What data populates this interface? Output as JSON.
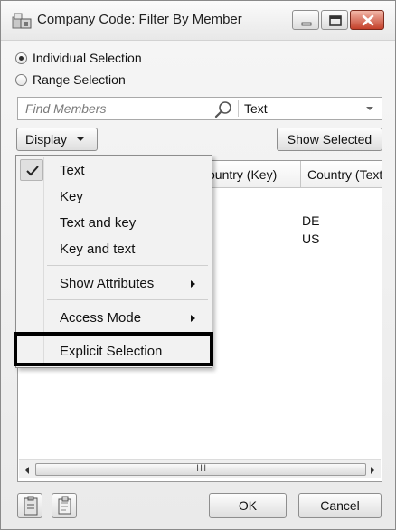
{
  "window": {
    "title": "Company Code: Filter By Member",
    "icons": [
      "app-icon",
      "minimize-icon",
      "maximize-icon",
      "close-icon"
    ]
  },
  "selection": {
    "individual_label": "Individual Selection",
    "range_label": "Range Selection",
    "selected": "Individual Selection"
  },
  "search": {
    "placeholder": "Find Members",
    "value": "",
    "mode": "Text"
  },
  "toolbar": {
    "display_label": "Display",
    "show_selected_label": "Show Selected"
  },
  "grid": {
    "columns": [
      "Country (Key)",
      "Country (Text)"
    ],
    "visible_headers": [
      "ountry (Key)",
      "Country (Text"
    ],
    "rows": [
      {
        "key": "",
        "text": "DE"
      },
      {
        "key": "",
        "text": "US"
      }
    ],
    "scroll_grip": "III"
  },
  "display_menu": {
    "items": [
      {
        "label": "Text",
        "checked": true
      },
      {
        "label": "Key",
        "checked": false
      },
      {
        "label": "Text and key",
        "checked": false
      },
      {
        "label": "Key and text",
        "checked": false
      },
      {
        "label": "Show Attributes",
        "submenu": true
      },
      {
        "label": "Access Mode",
        "submenu": true
      },
      {
        "label": "Explicit Selection",
        "highlighted": true
      }
    ]
  },
  "footer": {
    "ok_label": "OK",
    "cancel_label": "Cancel"
  },
  "colors": {
    "highlight_border": "#000000",
    "close_button": "#c4402a"
  }
}
